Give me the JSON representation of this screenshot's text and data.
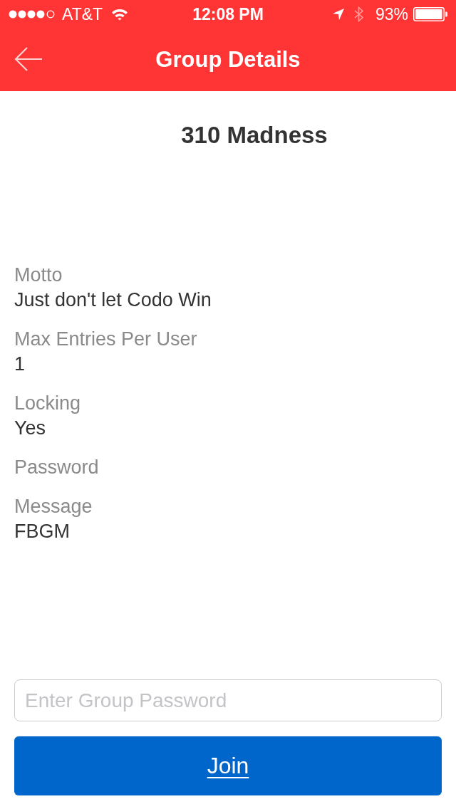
{
  "status_bar": {
    "carrier": "AT&T",
    "time": "12:08 PM",
    "battery": "93%"
  },
  "nav_bar": {
    "title": "Group Details"
  },
  "group": {
    "name": "310 Madness",
    "fields": [
      {
        "label": "Motto",
        "value": "Just don't let Codo Win"
      },
      {
        "label": "Max Entries Per User",
        "value": "1"
      },
      {
        "label": "Locking",
        "value": "Yes"
      },
      {
        "label": "Password"
      },
      {
        "label": "Message",
        "value": "FBGM"
      }
    ]
  },
  "password_field": {
    "placeholder": "Enter Group Password"
  },
  "join_button": {
    "label": "Join"
  }
}
